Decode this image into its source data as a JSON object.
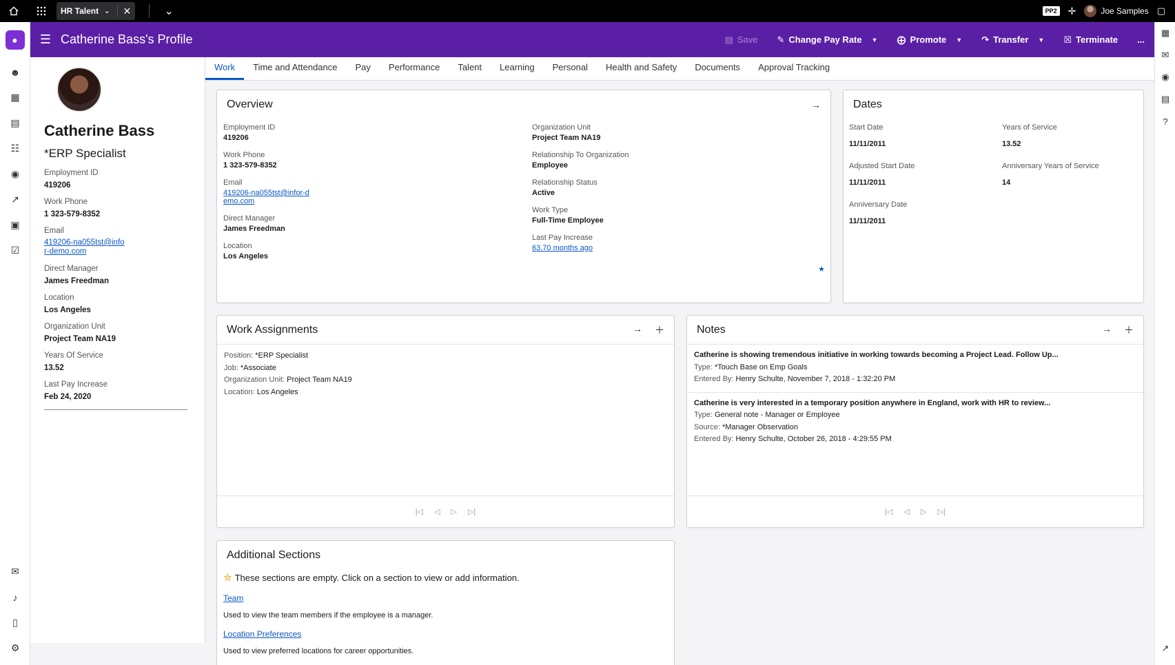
{
  "topbar": {
    "app_tab": "HR Talent",
    "env_badge": "PP2",
    "user": "Joe Samples"
  },
  "header": {
    "title": "Catherine Bass's Profile",
    "actions": {
      "save": "Save",
      "change_pay_rate": "Change Pay Rate",
      "promote": "Promote",
      "transfer": "Transfer",
      "terminate": "Terminate",
      "more": "..."
    }
  },
  "profile": {
    "name": "Catherine Bass",
    "role": "*ERP Specialist",
    "fields": [
      {
        "label": "Employment ID",
        "value": "419206"
      },
      {
        "label": "Work Phone",
        "value": "1 323-579-8352"
      },
      {
        "label": "Email",
        "value": "419206-na055tst@infor-demo.com"
      },
      {
        "label": "Direct Manager",
        "value": "James Freedman"
      },
      {
        "label": "Location",
        "value": "Los Angeles"
      },
      {
        "label": "Organization Unit",
        "value": "Project Team NA19"
      },
      {
        "label": "Years Of Service",
        "value": "13.52"
      },
      {
        "label": "Last Pay Increase",
        "value": "Feb 24, 2020"
      }
    ]
  },
  "tabs": [
    "Work",
    "Time and Attendance",
    "Pay",
    "Performance",
    "Talent",
    "Learning",
    "Personal",
    "Health and Safety",
    "Documents",
    "Approval Tracking"
  ],
  "overview": {
    "title": "Overview",
    "left": [
      {
        "label": "Employment ID",
        "value": "419206"
      },
      {
        "label": "Work Phone",
        "value": "1 323-579-8352"
      },
      {
        "label": "Email",
        "value": "419206-na055tst@infor-demo.com"
      },
      {
        "label": "Direct Manager",
        "value": "James Freedman"
      },
      {
        "label": "Location",
        "value": "Los Angeles"
      }
    ],
    "right": [
      {
        "label": "Organization Unit",
        "value": "Project Team NA19"
      },
      {
        "label": "Relationship To Organization",
        "value": "Employee"
      },
      {
        "label": "Relationship Status",
        "value": "Active"
      },
      {
        "label": "Work Type",
        "value": "Full-Time Employee"
      },
      {
        "label": "Last Pay Increase",
        "value": "63.70 months ago"
      }
    ]
  },
  "dates": {
    "title": "Dates",
    "items": [
      {
        "label": "Start Date",
        "value": "11/11/2011"
      },
      {
        "label": "Years of Service",
        "value": "13.52"
      },
      {
        "label": "Adjusted Start Date",
        "value": "11/11/2011"
      },
      {
        "label": "Anniversary Years of Service",
        "value": "14"
      },
      {
        "label": "Anniversary Date",
        "value": "11/11/2011"
      }
    ]
  },
  "work_assignments": {
    "title": "Work Assignments",
    "rows": [
      {
        "label": "Position:",
        "value": "*ERP Specialist"
      },
      {
        "label": "Job:",
        "value": "*Associate"
      },
      {
        "label": "Organization Unit:",
        "value": "Project Team NA19"
      },
      {
        "label": "Location:",
        "value": "Los Angeles"
      }
    ]
  },
  "notes": {
    "title": "Notes",
    "items": [
      {
        "title": "Catherine is showing tremendous initiative in working towards becoming a Project Lead.  Follow Up...",
        "lines": [
          {
            "label": "Type:",
            "value": "*Touch Base on Emp Goals"
          },
          {
            "label": "Entered By:",
            "value": "Henry Schulte, November 7, 2018 - 1:32:20 PM"
          }
        ]
      },
      {
        "title": "Catherine is very interested in a temporary position anywhere in England, work with HR to review...",
        "lines": [
          {
            "label": "Type:",
            "value": "General note - Manager or Employee"
          },
          {
            "label": "Source:",
            "value": "*Manager Observation"
          },
          {
            "label": "Entered By:",
            "value": "Henry Schulte, October 26, 2018 - 4:29:55 PM"
          }
        ]
      }
    ]
  },
  "additional": {
    "title": "Additional Sections",
    "intro": "These sections are empty. Click on a section to view or add information.",
    "sections": [
      {
        "link": "Team",
        "desc": "Used to view the team members if the employee is a manager."
      },
      {
        "link": "Location Preferences",
        "desc": "Used to view preferred locations for career opportunities."
      }
    ]
  },
  "colors": {
    "header": "#5b1fa6",
    "link": "#0a57c8",
    "accent_star": "#f2a516"
  }
}
